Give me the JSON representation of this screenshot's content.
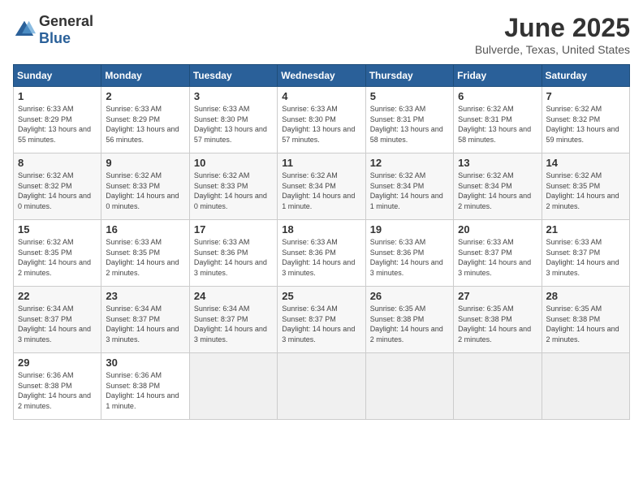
{
  "header": {
    "logo_general": "General",
    "logo_blue": "Blue",
    "month": "June 2025",
    "location": "Bulverde, Texas, United States"
  },
  "days_of_week": [
    "Sunday",
    "Monday",
    "Tuesday",
    "Wednesday",
    "Thursday",
    "Friday",
    "Saturday"
  ],
  "weeks": [
    [
      {
        "day": "1",
        "sunrise": "Sunrise: 6:33 AM",
        "sunset": "Sunset: 8:29 PM",
        "daylight": "Daylight: 13 hours and 55 minutes."
      },
      {
        "day": "2",
        "sunrise": "Sunrise: 6:33 AM",
        "sunset": "Sunset: 8:29 PM",
        "daylight": "Daylight: 13 hours and 56 minutes."
      },
      {
        "day": "3",
        "sunrise": "Sunrise: 6:33 AM",
        "sunset": "Sunset: 8:30 PM",
        "daylight": "Daylight: 13 hours and 57 minutes."
      },
      {
        "day": "4",
        "sunrise": "Sunrise: 6:33 AM",
        "sunset": "Sunset: 8:30 PM",
        "daylight": "Daylight: 13 hours and 57 minutes."
      },
      {
        "day": "5",
        "sunrise": "Sunrise: 6:33 AM",
        "sunset": "Sunset: 8:31 PM",
        "daylight": "Daylight: 13 hours and 58 minutes."
      },
      {
        "day": "6",
        "sunrise": "Sunrise: 6:32 AM",
        "sunset": "Sunset: 8:31 PM",
        "daylight": "Daylight: 13 hours and 58 minutes."
      },
      {
        "day": "7",
        "sunrise": "Sunrise: 6:32 AM",
        "sunset": "Sunset: 8:32 PM",
        "daylight": "Daylight: 13 hours and 59 minutes."
      }
    ],
    [
      {
        "day": "8",
        "sunrise": "Sunrise: 6:32 AM",
        "sunset": "Sunset: 8:32 PM",
        "daylight": "Daylight: 14 hours and 0 minutes."
      },
      {
        "day": "9",
        "sunrise": "Sunrise: 6:32 AM",
        "sunset": "Sunset: 8:33 PM",
        "daylight": "Daylight: 14 hours and 0 minutes."
      },
      {
        "day": "10",
        "sunrise": "Sunrise: 6:32 AM",
        "sunset": "Sunset: 8:33 PM",
        "daylight": "Daylight: 14 hours and 0 minutes."
      },
      {
        "day": "11",
        "sunrise": "Sunrise: 6:32 AM",
        "sunset": "Sunset: 8:34 PM",
        "daylight": "Daylight: 14 hours and 1 minute."
      },
      {
        "day": "12",
        "sunrise": "Sunrise: 6:32 AM",
        "sunset": "Sunset: 8:34 PM",
        "daylight": "Daylight: 14 hours and 1 minute."
      },
      {
        "day": "13",
        "sunrise": "Sunrise: 6:32 AM",
        "sunset": "Sunset: 8:34 PM",
        "daylight": "Daylight: 14 hours and 2 minutes."
      },
      {
        "day": "14",
        "sunrise": "Sunrise: 6:32 AM",
        "sunset": "Sunset: 8:35 PM",
        "daylight": "Daylight: 14 hours and 2 minutes."
      }
    ],
    [
      {
        "day": "15",
        "sunrise": "Sunrise: 6:32 AM",
        "sunset": "Sunset: 8:35 PM",
        "daylight": "Daylight: 14 hours and 2 minutes."
      },
      {
        "day": "16",
        "sunrise": "Sunrise: 6:33 AM",
        "sunset": "Sunset: 8:35 PM",
        "daylight": "Daylight: 14 hours and 2 minutes."
      },
      {
        "day": "17",
        "sunrise": "Sunrise: 6:33 AM",
        "sunset": "Sunset: 8:36 PM",
        "daylight": "Daylight: 14 hours and 3 minutes."
      },
      {
        "day": "18",
        "sunrise": "Sunrise: 6:33 AM",
        "sunset": "Sunset: 8:36 PM",
        "daylight": "Daylight: 14 hours and 3 minutes."
      },
      {
        "day": "19",
        "sunrise": "Sunrise: 6:33 AM",
        "sunset": "Sunset: 8:36 PM",
        "daylight": "Daylight: 14 hours and 3 minutes."
      },
      {
        "day": "20",
        "sunrise": "Sunrise: 6:33 AM",
        "sunset": "Sunset: 8:37 PM",
        "daylight": "Daylight: 14 hours and 3 minutes."
      },
      {
        "day": "21",
        "sunrise": "Sunrise: 6:33 AM",
        "sunset": "Sunset: 8:37 PM",
        "daylight": "Daylight: 14 hours and 3 minutes."
      }
    ],
    [
      {
        "day": "22",
        "sunrise": "Sunrise: 6:34 AM",
        "sunset": "Sunset: 8:37 PM",
        "daylight": "Daylight: 14 hours and 3 minutes."
      },
      {
        "day": "23",
        "sunrise": "Sunrise: 6:34 AM",
        "sunset": "Sunset: 8:37 PM",
        "daylight": "Daylight: 14 hours and 3 minutes."
      },
      {
        "day": "24",
        "sunrise": "Sunrise: 6:34 AM",
        "sunset": "Sunset: 8:37 PM",
        "daylight": "Daylight: 14 hours and 3 minutes."
      },
      {
        "day": "25",
        "sunrise": "Sunrise: 6:34 AM",
        "sunset": "Sunset: 8:37 PM",
        "daylight": "Daylight: 14 hours and 3 minutes."
      },
      {
        "day": "26",
        "sunrise": "Sunrise: 6:35 AM",
        "sunset": "Sunset: 8:38 PM",
        "daylight": "Daylight: 14 hours and 2 minutes."
      },
      {
        "day": "27",
        "sunrise": "Sunrise: 6:35 AM",
        "sunset": "Sunset: 8:38 PM",
        "daylight": "Daylight: 14 hours and 2 minutes."
      },
      {
        "day": "28",
        "sunrise": "Sunrise: 6:35 AM",
        "sunset": "Sunset: 8:38 PM",
        "daylight": "Daylight: 14 hours and 2 minutes."
      }
    ],
    [
      {
        "day": "29",
        "sunrise": "Sunrise: 6:36 AM",
        "sunset": "Sunset: 8:38 PM",
        "daylight": "Daylight: 14 hours and 2 minutes."
      },
      {
        "day": "30",
        "sunrise": "Sunrise: 6:36 AM",
        "sunset": "Sunset: 8:38 PM",
        "daylight": "Daylight: 14 hours and 1 minute."
      },
      null,
      null,
      null,
      null,
      null
    ]
  ]
}
